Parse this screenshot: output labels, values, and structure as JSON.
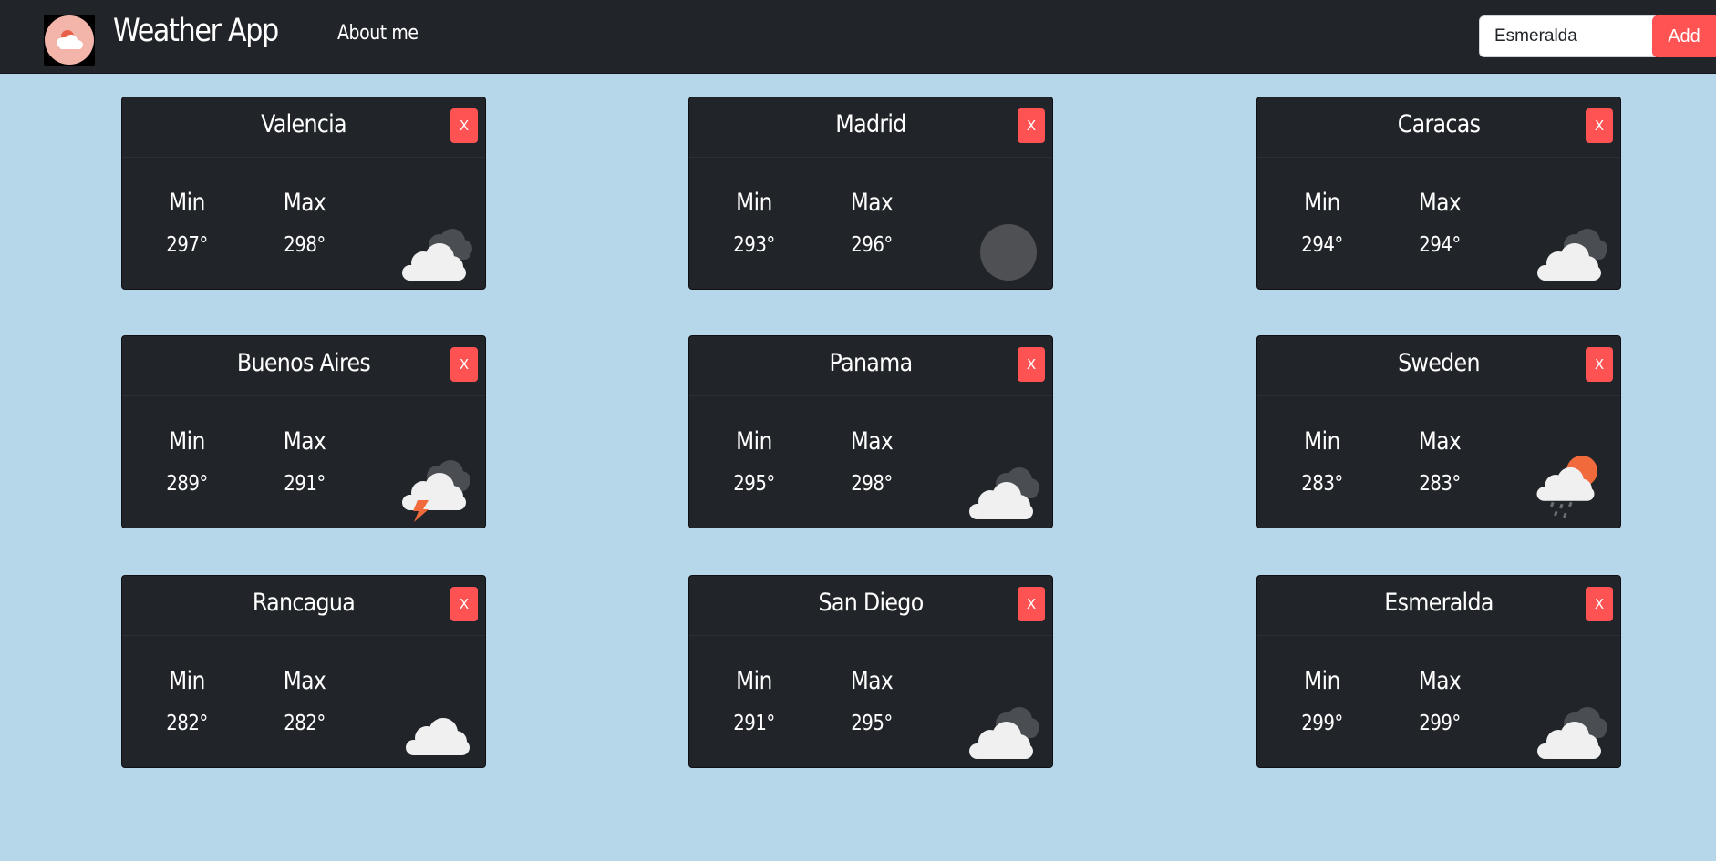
{
  "navbar": {
    "logo_icon": "weather-logo-icon",
    "brand": "Weather App",
    "about_link": "About me",
    "search": {
      "value": "Esmeralda",
      "placeholder": ""
    },
    "add_label": "Add"
  },
  "labels": {
    "min": "Min",
    "max": "Max",
    "close": "X"
  },
  "colors": {
    "background": "#b6d6e9",
    "navbar": "#212529",
    "card": "#212529",
    "accent": "#ff5252"
  },
  "cards": [
    {
      "city": "Valencia",
      "min": "297°",
      "max": "298°",
      "icon": "cloudy-icon"
    },
    {
      "city": "Madrid",
      "min": "293°",
      "max": "296°",
      "icon": "moon-icon"
    },
    {
      "city": "Caracas",
      "min": "294°",
      "max": "294°",
      "icon": "cloudy-icon"
    },
    {
      "city": "Buenos Aires",
      "min": "289°",
      "max": "291°",
      "icon": "thunderstorm-icon"
    },
    {
      "city": "Panama",
      "min": "295°",
      "max": "298°",
      "icon": "cloudy-icon"
    },
    {
      "city": "Sweden",
      "min": "283°",
      "max": "283°",
      "icon": "rain-sun-icon"
    },
    {
      "city": "Rancagua",
      "min": "282°",
      "max": "282°",
      "icon": "cloud-icon"
    },
    {
      "city": "San Diego",
      "min": "291°",
      "max": "295°",
      "icon": "cloudy-icon"
    },
    {
      "city": "Esmeralda",
      "min": "299°",
      "max": "299°",
      "icon": "cloudy-icon"
    }
  ]
}
